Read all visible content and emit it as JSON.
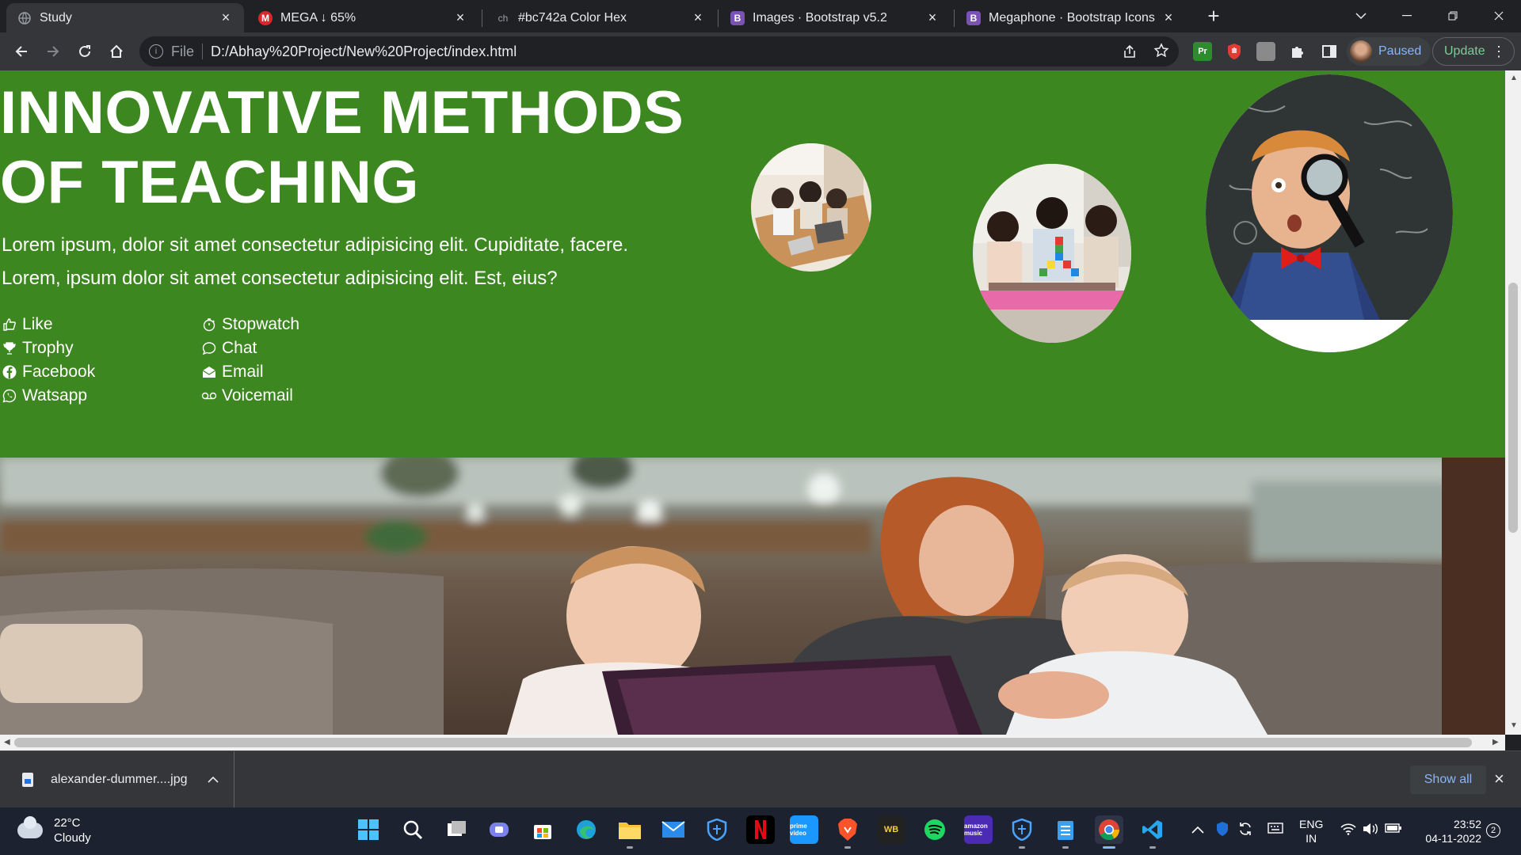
{
  "browser": {
    "tabs": [
      {
        "title": "Study",
        "favicon": "globe-icon",
        "active": true
      },
      {
        "title": "MEGA ↓ 65%",
        "favicon": "mega-icon",
        "favicon_text": "M",
        "active": false
      },
      {
        "title": "#bc742a Color Hex",
        "favicon": "colorhexa-icon",
        "favicon_text": "ch",
        "active": false
      },
      {
        "title": "Images · Bootstrap v5.2",
        "favicon": "bootstrap-icon",
        "favicon_text": "B",
        "active": false
      },
      {
        "title": "Megaphone · Bootstrap Icons",
        "favicon": "bootstrap-icon",
        "favicon_text": "B",
        "active": false
      }
    ],
    "address": {
      "file_label": "File",
      "url": "D:/Abhay%20Project/New%20Project/index.html"
    },
    "profile_status": "Paused",
    "update_label": "Update",
    "extensions": [
      "premiere-ext-icon",
      "shield-ext-icon",
      "gray-ext-icon",
      "puzzle-icon",
      "sidepanel-icon"
    ]
  },
  "page": {
    "hero_title": "INNOVATIVE METHODS OF TEACHING",
    "hero_text": "Lorem ipsum, dolor sit amet consectetur adipisicing elit. Cupiditate, facere. Lorem, ipsum dolor sit amet consectetur adipisicing elit. Est, eius?",
    "icon_list_left": [
      {
        "label": "Like",
        "icon": "thumbs-up-icon"
      },
      {
        "label": "Trophy",
        "icon": "trophy-icon"
      },
      {
        "label": "Facebook",
        "icon": "facebook-icon"
      },
      {
        "label": "Watsapp",
        "icon": "whatsapp-icon"
      }
    ],
    "icon_list_right": [
      {
        "label": "Stopwatch",
        "icon": "stopwatch-icon"
      },
      {
        "label": "Chat",
        "icon": "chat-icon"
      },
      {
        "label": "Email",
        "icon": "envelope-open-icon"
      },
      {
        "label": "Voicemail",
        "icon": "voicemail-icon"
      }
    ],
    "hero_bg": "#3d8720"
  },
  "download_bar": {
    "filename": "alexander-dummer....jpg",
    "show_all": "Show all"
  },
  "taskbar": {
    "weather_temp": "22°C",
    "weather_desc": "Cloudy",
    "apps": [
      "windows-start-icon",
      "search-icon",
      "task-view-icon",
      "teams-chat-icon",
      "store-icon",
      "edge-icon",
      "file-explorer-icon",
      "mail-icon",
      "app-shield-icon",
      "netflix-icon",
      "prime-video-icon",
      "brave-icon",
      "wb-icon",
      "spotify-icon",
      "amazon-music-icon",
      "app-shield2-icon",
      "notepad-icon",
      "chrome-icon",
      "vscode-icon"
    ],
    "language_line1": "ENG",
    "language_line2": "IN",
    "time": "23:52",
    "date": "04-11-2022",
    "notification_count": "2"
  }
}
